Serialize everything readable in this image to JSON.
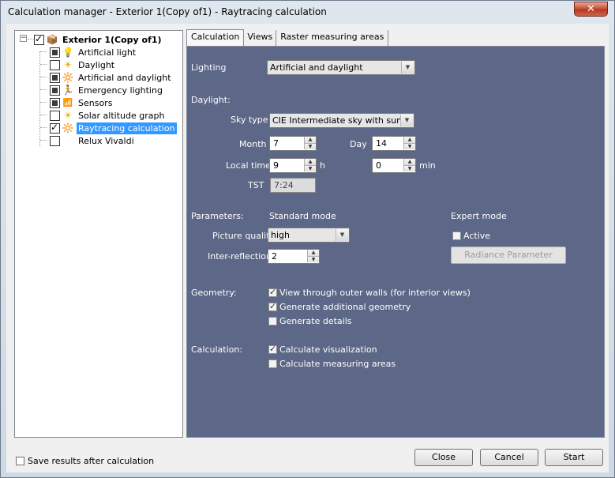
{
  "window": {
    "title": "Calculation manager - Exterior 1(Copy of1)  - Raytracing calculation",
    "close_glyph": "✕"
  },
  "tree": {
    "expander": "−",
    "root": "Exterior 1(Copy of1)",
    "items": [
      {
        "label": "Artificial light",
        "icon": "lightbulb-icon",
        "glyph": "💡"
      },
      {
        "label": "Daylight",
        "icon": "sun-icon",
        "glyph": "☀"
      },
      {
        "label": "Artificial and daylight",
        "icon": "bulb-sun-icon",
        "glyph": "🔆"
      },
      {
        "label": "Emergency lighting",
        "icon": "emergency-exit-icon",
        "glyph": "🏃"
      },
      {
        "label": "Sensors",
        "icon": "sensor-icon",
        "glyph": "📶"
      },
      {
        "label": "Solar altitude graph",
        "icon": "solar-graph-icon",
        "glyph": "☀"
      },
      {
        "label": "Raytracing calculation",
        "icon": "raytracing-icon",
        "glyph": "🔆"
      },
      {
        "label": "Relux Vivaldi",
        "icon": "vivaldi-icon",
        "glyph": ""
      }
    ]
  },
  "tabs": [
    "Calculation",
    "Views",
    "Raster measuring areas"
  ],
  "form": {
    "lighting_label": "Lighting",
    "lighting_value": "Artificial and daylight",
    "daylight_label": "Daylight:",
    "sky_type_label": "Sky type",
    "sky_type_value": "CIE Intermediate sky with sun",
    "month_label": "Month",
    "month_value": "7",
    "day_label": "Day",
    "day_value": "14",
    "local_time_label": "Local time",
    "hour_value": "9",
    "hour_unit": "h",
    "min_value": "0",
    "min_unit": "min",
    "tst_label": "TST",
    "tst_value": "7:24",
    "parameters_label": "Parameters:",
    "standard_mode_label": "Standard mode",
    "expert_mode_label": "Expert mode",
    "picture_quality_label": "Picture quality",
    "picture_quality_value": "high",
    "inter_reflections_label": "Inter-reflections",
    "inter_reflections_value": "2",
    "active_label": "Active",
    "radiance_button": "Radiance Parameter",
    "geometry_label": "Geometry:",
    "view_through_label": "View through outer walls (for interior views)",
    "generate_geometry_label": "Generate additional geometry",
    "generate_details_label": "Generate details",
    "calculation_label": "Calculation:",
    "calc_visualization_label": "Calculate visualization",
    "calc_measuring_label": "Calculate measuring areas"
  },
  "footer": {
    "save_results_label": "Save results after calculation",
    "close_button": "Close",
    "cancel_button": "Cancel",
    "start_button": "Start"
  },
  "colors": {
    "panel_bg": "#5d6787",
    "selection": "#3399ff",
    "close_button": "#c74b33"
  }
}
